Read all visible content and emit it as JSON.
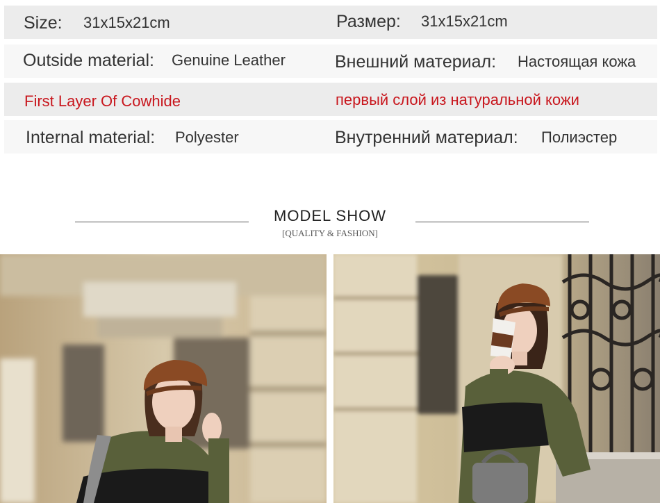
{
  "specs": {
    "rows": [
      {
        "en_label": "Size:",
        "en_value": "31x15x21cm",
        "ru_label": "Размер:",
        "ru_value": "31x15x21cm"
      },
      {
        "en_label": "Outside material:",
        "en_value": "Genuine Leather",
        "ru_label": "Внешний материал:",
        "ru_value": "Настоящая кожа"
      },
      {
        "en_text": "First Layer Of Cowhide",
        "ru_text": "первый слой из натуральной кожи"
      },
      {
        "en_label": "Internal material:",
        "en_value": "Polyester",
        "ru_label": "Внутренний материал:",
        "ru_value": "Полиэстер"
      }
    ]
  },
  "section": {
    "title": "MODEL SHOW",
    "subtitle": "[QUALITY & FASHION]"
  },
  "colors": {
    "accent_red": "#c8161d",
    "row_shade": "#ececec",
    "hat": "#8a4a24",
    "sweater_green": "#59603a",
    "sweater_black": "#1a1a1a"
  },
  "photos": [
    {
      "name": "model-photo-left"
    },
    {
      "name": "model-photo-right"
    }
  ]
}
